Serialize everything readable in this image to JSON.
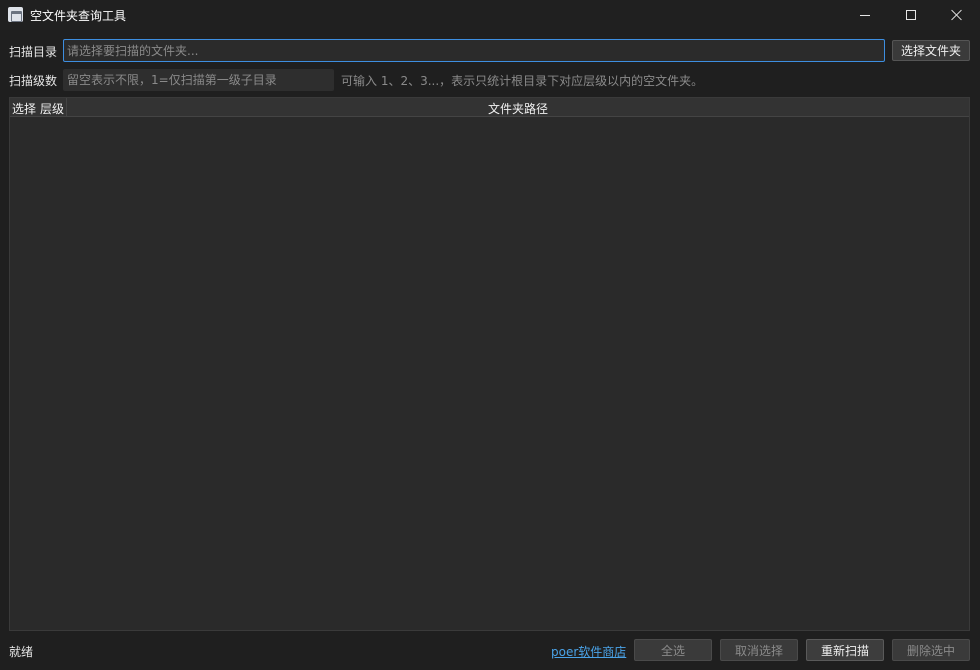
{
  "window": {
    "title": "空文件夹查询工具"
  },
  "scan_dir": {
    "label": "扫描目录",
    "placeholder": "请选择要扫描的文件夹...",
    "choose_button": "选择文件夹"
  },
  "scan_level": {
    "label": "扫描级数",
    "placeholder": "留空表示不限，1=仅扫描第一级子目录",
    "hint": "可输入 1、2、3...，表示只统计根目录下对应层级以内的空文件夹。"
  },
  "table": {
    "columns": [
      "选择",
      "层级",
      "文件夹路径"
    ],
    "rows": []
  },
  "footer": {
    "status": "就绪",
    "store_link": "poer软件商店",
    "select_all": "全选",
    "deselect": "取消选择",
    "rescan": "重新扫描",
    "delete_selected": "删除选中"
  }
}
